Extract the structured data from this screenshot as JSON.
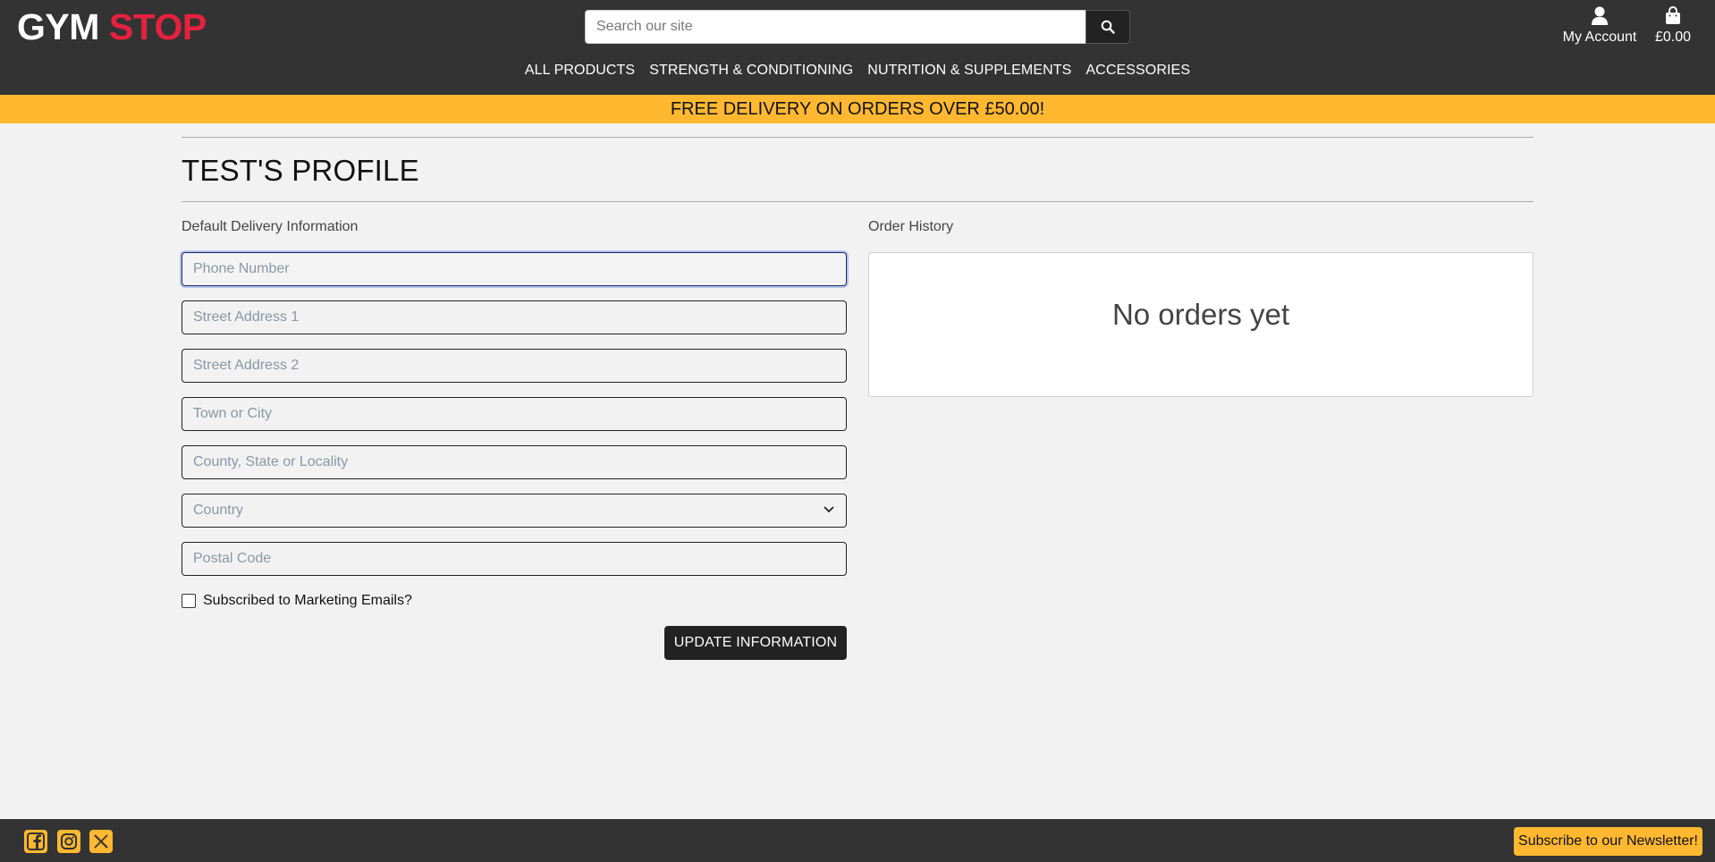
{
  "header": {
    "logo_part1": "GYM",
    "logo_part2": "STOP",
    "search_placeholder": "Search our site",
    "account_label": "My Account",
    "bag_total": "£0.00"
  },
  "nav": {
    "items": [
      "ALL PRODUCTS",
      "STRENGTH & CONDITIONING",
      "NUTRITION & SUPPLEMENTS",
      "ACCESSORIES"
    ]
  },
  "banner": {
    "text": "FREE DELIVERY ON ORDERS OVER £50.00!"
  },
  "profile": {
    "title": "TEST'S PROFILE",
    "delivery_label": "Default Delivery Information",
    "fields": {
      "phone": "Phone Number",
      "street1": "Street Address 1",
      "street2": "Street Address 2",
      "town": "Town or City",
      "county": "County, State or Locality",
      "country": "Country",
      "postcode": "Postal Code"
    },
    "marketing_label": "Subscribed to Marketing Emails?",
    "update_button": "UPDATE INFORMATION",
    "orders_label": "Order History",
    "orders_empty": "No orders yet"
  },
  "footer": {
    "newsletter_button": "Subscribe to our Newsletter!"
  },
  "colors": {
    "header_bg": "#333333",
    "accent": "#ffb830",
    "logo_red": "#e5213f"
  }
}
